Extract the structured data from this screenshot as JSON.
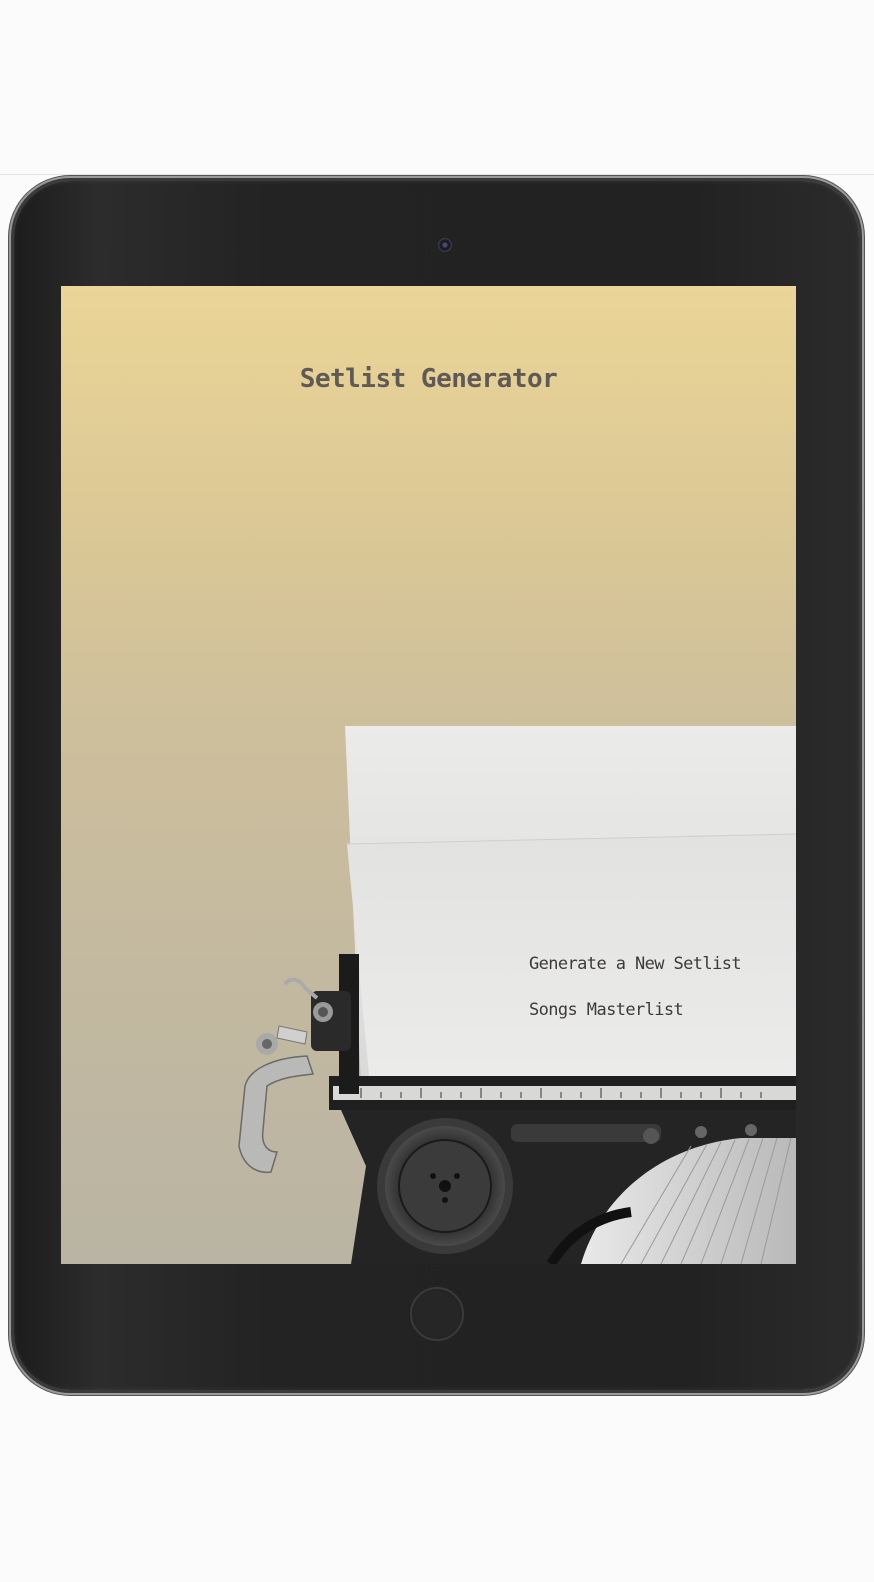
{
  "app": {
    "title": "Setlist Generator"
  },
  "menu": {
    "items": [
      {
        "label": "Generate a New Setlist"
      },
      {
        "label": "Songs Masterlist"
      }
    ]
  },
  "colors": {
    "background_top": "#ebd597",
    "background_bottom": "#b9b4a3",
    "text": "#5f5a56",
    "bezel": "#222222"
  },
  "icons": {
    "camera": "camera-icon",
    "home": "home-button-icon"
  }
}
